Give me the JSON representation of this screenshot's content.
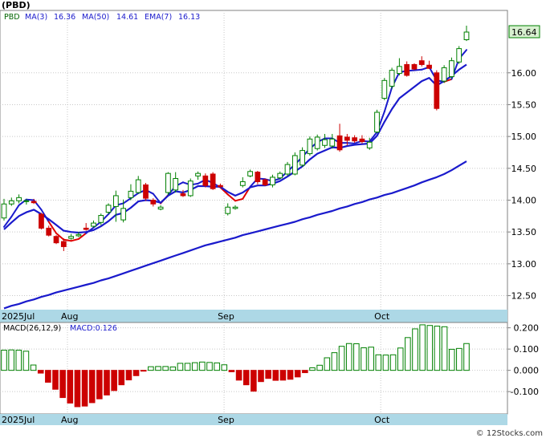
{
  "symbol_label": "(PBD)",
  "legend": {
    "ticker": "PBD",
    "ma3_label": "MA(3)",
    "ma3_value": "16.36",
    "ma50_label": "MA(50)",
    "ma50_value": "14.61",
    "ema7_label": "EMA(7)",
    "ema7_value": "16.13"
  },
  "last_price_label": "16.64",
  "macd_legend": {
    "params_label": "MACD(26,12,9)",
    "value_label": "MACD:0.126"
  },
  "month_labels": [
    "2025Jul",
    "Aug",
    "Sep",
    "Oct"
  ],
  "watermark": "© 12Stocks.com",
  "colors": {
    "up_candle": "#008000",
    "down_candle": "#cc0000",
    "ma_line": "#1a1acc",
    "ema_line": "#e00000",
    "axis_bar": "#add8e6"
  },
  "chart_data": [
    {
      "type": "candlestick",
      "title": "(PBD)",
      "y_ticks": [
        12.5,
        13.0,
        13.5,
        14.0,
        14.5,
        15.0,
        15.5,
        16.0
      ],
      "ylim": [
        12.28,
        16.98
      ],
      "grid": true,
      "dates": [
        "2025-07-21",
        "2025-07-22",
        "2025-07-23",
        "2025-07-24",
        "2025-07-25",
        "2025-07-28",
        "2025-07-29",
        "2025-07-30",
        "2025-07-31",
        "2025-08-01",
        "2025-08-04",
        "2025-08-05",
        "2025-08-06",
        "2025-08-07",
        "2025-08-08",
        "2025-08-11",
        "2025-08-12",
        "2025-08-13",
        "2025-08-14",
        "2025-08-15",
        "2025-08-18",
        "2025-08-19",
        "2025-08-20",
        "2025-08-21",
        "2025-08-22",
        "2025-08-25",
        "2025-08-26",
        "2025-08-27",
        "2025-08-28",
        "2025-08-29",
        "2025-09-02",
        "2025-09-03",
        "2025-09-04",
        "2025-09-05",
        "2025-09-08",
        "2025-09-09",
        "2025-09-10",
        "2025-09-11",
        "2025-09-12",
        "2025-09-15",
        "2025-09-16",
        "2025-09-17",
        "2025-09-18",
        "2025-09-19",
        "2025-09-22",
        "2025-09-23",
        "2025-09-24",
        "2025-09-25",
        "2025-09-26",
        "2025-09-29",
        "2025-09-30",
        "2025-10-01",
        "2025-10-02",
        "2025-10-03",
        "2025-10-06",
        "2025-10-07",
        "2025-10-08",
        "2025-10-09",
        "2025-10-10",
        "2025-10-13",
        "2025-10-14",
        "2025-10-15",
        "2025-10-16"
      ],
      "open": [
        13.72,
        13.94,
        13.99,
        13.98,
        13.98,
        13.78,
        13.56,
        13.43,
        13.35,
        13.4,
        13.44,
        13.56,
        13.59,
        13.65,
        13.81,
        13.9,
        13.69,
        14.04,
        14.12,
        14.24,
        14.0,
        13.86,
        14.12,
        14.16,
        14.1,
        14.07,
        14.38,
        14.38,
        14.41,
        14.23,
        13.79,
        13.87,
        14.23,
        14.38,
        14.44,
        14.32,
        14.24,
        14.35,
        14.41,
        14.41,
        14.55,
        14.73,
        14.81,
        14.86,
        14.85,
        15.01,
        14.99,
        14.98,
        14.96,
        14.82,
        15.07,
        15.6,
        15.79,
        15.99,
        16.13,
        16.13,
        16.19,
        16.12,
        16.0,
        15.87,
        15.94,
        16.17,
        16.52
      ],
      "close": [
        13.94,
        13.99,
        14.04,
        13.99,
        13.96,
        13.56,
        13.45,
        13.33,
        13.27,
        13.43,
        13.46,
        13.54,
        13.64,
        13.76,
        13.92,
        14.07,
        13.87,
        14.14,
        14.32,
        14.03,
        13.94,
        13.89,
        14.42,
        14.34,
        14.07,
        14.3,
        14.42,
        14.23,
        14.18,
        14.21,
        13.89,
        13.89,
        14.29,
        14.45,
        14.29,
        14.24,
        14.36,
        14.42,
        14.56,
        14.7,
        14.78,
        14.96,
        14.99,
        14.95,
        14.96,
        14.79,
        14.94,
        14.93,
        14.92,
        14.91,
        15.38,
        15.88,
        16.04,
        16.1,
        15.96,
        16.06,
        16.13,
        16.07,
        15.44,
        16.08,
        16.19,
        16.38,
        16.64
      ],
      "high": [
        14.02,
        14.04,
        14.09,
        14.02,
        14.02,
        13.8,
        13.6,
        13.45,
        13.4,
        13.47,
        13.5,
        13.64,
        13.68,
        13.79,
        13.95,
        14.15,
        14.01,
        14.25,
        14.38,
        14.27,
        14.03,
        13.92,
        14.44,
        14.44,
        14.16,
        14.34,
        14.45,
        14.42,
        14.44,
        14.26,
        13.95,
        13.92,
        14.36,
        14.48,
        14.46,
        14.34,
        14.4,
        14.45,
        14.6,
        14.75,
        14.83,
        15.0,
        15.03,
        15.04,
        15.04,
        15.2,
        15.04,
        15.02,
        15.02,
        14.98,
        15.42,
        15.92,
        16.08,
        16.23,
        16.18,
        16.15,
        16.26,
        16.19,
        16.04,
        16.12,
        16.24,
        16.42,
        16.74
      ],
      "low": [
        13.68,
        13.91,
        13.95,
        13.93,
        13.94,
        13.54,
        13.43,
        13.31,
        13.2,
        13.38,
        13.42,
        13.52,
        13.57,
        13.61,
        13.78,
        13.66,
        13.65,
        14.0,
        14.1,
        13.99,
        13.9,
        13.84,
        14.08,
        14.12,
        14.05,
        14.05,
        14.32,
        14.2,
        14.16,
        14.2,
        13.76,
        13.85,
        14.2,
        14.36,
        14.25,
        14.22,
        14.2,
        14.33,
        14.38,
        14.39,
        14.52,
        14.7,
        14.78,
        14.82,
        14.81,
        14.76,
        14.86,
        14.9,
        14.89,
        14.79,
        15.05,
        15.57,
        15.75,
        15.96,
        15.94,
        16.04,
        16.1,
        16.06,
        15.41,
        15.84,
        15.91,
        16.14,
        16.5
      ],
      "ma3": [
        13.58,
        13.74,
        13.92,
        14.01,
        14.0,
        13.85,
        13.66,
        13.48,
        13.38,
        13.36,
        13.39,
        13.48,
        13.57,
        13.66,
        13.78,
        13.92,
        13.95,
        14.03,
        14.11,
        14.16,
        14.1,
        13.95,
        14.08,
        14.22,
        14.28,
        14.24,
        14.26,
        14.32,
        14.27,
        14.2,
        14.09,
        13.99,
        14.02,
        14.21,
        14.34,
        14.33,
        14.3,
        14.34,
        14.45,
        14.56,
        14.68,
        14.81,
        14.91,
        14.97,
        14.97,
        14.9,
        14.9,
        14.89,
        14.93,
        14.92,
        15.07,
        15.39,
        15.77,
        16.01,
        16.03,
        16.04,
        16.05,
        16.09,
        15.88,
        15.86,
        15.9,
        16.22,
        16.36
      ],
      "ema7": [
        13.54,
        13.65,
        13.75,
        13.81,
        13.85,
        13.78,
        13.7,
        13.61,
        13.52,
        13.5,
        13.49,
        13.5,
        13.53,
        13.59,
        13.67,
        13.77,
        13.8,
        13.88,
        13.98,
        14.0,
        13.99,
        13.96,
        14.07,
        14.14,
        14.12,
        14.16,
        14.22,
        14.22,
        14.21,
        14.21,
        14.13,
        14.07,
        14.12,
        14.2,
        14.23,
        14.23,
        14.26,
        14.3,
        14.37,
        14.45,
        14.53,
        14.64,
        14.73,
        14.78,
        14.83,
        14.82,
        14.85,
        14.87,
        14.88,
        14.89,
        15.01,
        15.23,
        15.43,
        15.6,
        15.69,
        15.78,
        15.87,
        15.92,
        15.8,
        15.87,
        15.95,
        16.05,
        16.13
      ],
      "ma50": [
        12.3,
        12.34,
        12.37,
        12.41,
        12.44,
        12.48,
        12.51,
        12.55,
        12.58,
        12.61,
        12.64,
        12.67,
        12.7,
        12.74,
        12.77,
        12.81,
        12.85,
        12.89,
        12.93,
        12.97,
        13.01,
        13.05,
        13.09,
        13.13,
        13.17,
        13.21,
        13.25,
        13.29,
        13.32,
        13.35,
        13.38,
        13.41,
        13.45,
        13.48,
        13.51,
        13.54,
        13.57,
        13.6,
        13.63,
        13.66,
        13.7,
        13.73,
        13.77,
        13.8,
        13.83,
        13.87,
        13.9,
        13.94,
        13.97,
        14.01,
        14.04,
        14.08,
        14.11,
        14.15,
        14.19,
        14.23,
        14.28,
        14.32,
        14.36,
        14.41,
        14.47,
        14.54,
        14.61
      ]
    },
    {
      "type": "bar",
      "title": "MACD(26,12,9)",
      "series": [
        {
          "name": "MACD",
          "values": [
            0.095,
            0.096,
            0.095,
            0.09,
            0.025,
            -0.013,
            -0.056,
            -0.089,
            -0.128,
            -0.154,
            -0.171,
            -0.168,
            -0.152,
            -0.134,
            -0.116,
            -0.095,
            -0.068,
            -0.045,
            -0.025,
            -0.002,
            0.017,
            0.018,
            0.018,
            0.016,
            0.033,
            0.033,
            0.036,
            0.039,
            0.037,
            0.035,
            0.026,
            -0.007,
            -0.046,
            -0.068,
            -0.098,
            -0.053,
            -0.038,
            -0.047,
            -0.046,
            -0.042,
            -0.031,
            -0.011,
            0.012,
            0.024,
            0.059,
            0.083,
            0.113,
            0.126,
            0.125,
            0.106,
            0.109,
            0.073,
            0.072,
            0.073,
            0.105,
            0.154,
            0.195,
            0.214,
            0.211,
            0.208,
            0.205,
            0.099,
            0.103,
            0.126
          ]
        }
      ],
      "y_ticks": [
        -0.1,
        0.0,
        0.1,
        0.2
      ],
      "ylim": [
        -0.205,
        0.225
      ]
    }
  ]
}
